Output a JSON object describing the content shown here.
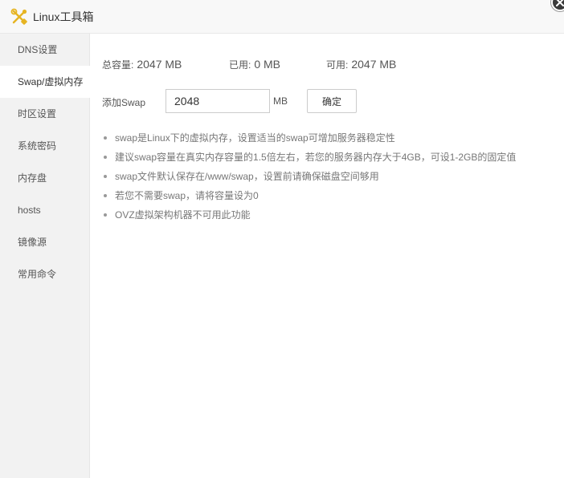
{
  "window": {
    "title": "Linux工具箱",
    "icon": "tools-icon"
  },
  "sidebar": {
    "items": [
      {
        "label": "DNS设置",
        "active": false
      },
      {
        "label": "Swap/虚拟内存",
        "active": true
      },
      {
        "label": "时区设置",
        "active": false
      },
      {
        "label": "系统密码",
        "active": false
      },
      {
        "label": "内存盘",
        "active": false
      },
      {
        "label": "hosts",
        "active": false
      },
      {
        "label": "镜像源",
        "active": false
      },
      {
        "label": "常用命令",
        "active": false
      }
    ]
  },
  "stats": {
    "total_label": "总容量:",
    "total_value": "2047 MB",
    "used_label": "已用:",
    "used_value": "0 MB",
    "avail_label": "可用:",
    "avail_value": "2047 MB"
  },
  "add_swap": {
    "label": "添加Swap",
    "value": "2048",
    "unit": "MB",
    "confirm_label": "确定"
  },
  "tips": [
    "swap是Linux下的虚拟内存，设置适当的swap可增加服务器稳定性",
    "建议swap容量在真实内存容量的1.5倍左右，若您的服务器内存大于4GB，可设1-2GB的固定值",
    "swap文件默认保存在/www/swap，设置前请确保磁盘空间够用",
    "若您不需要swap，请将容量设为0",
    "OVZ虚拟架构机器不可用此功能"
  ],
  "colors": {
    "sidebar_bg": "#f2f2f2",
    "active_bg": "#ffffff",
    "icon_accent": "#e6b422"
  }
}
